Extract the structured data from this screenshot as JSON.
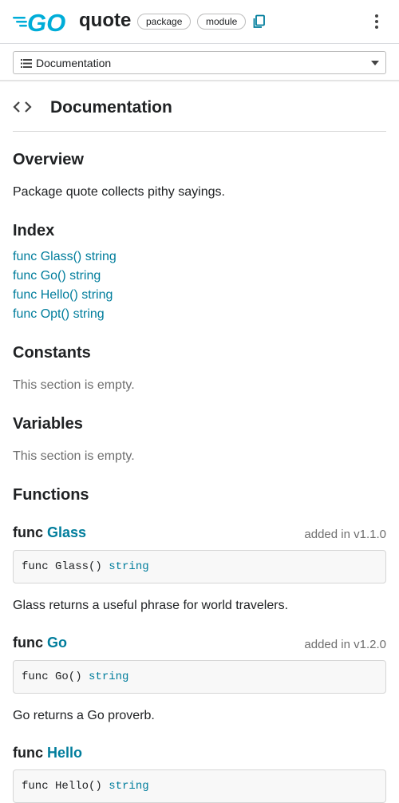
{
  "header": {
    "logo_icon": "go-logo-icon",
    "package_name": "quote",
    "badges": [
      "package",
      "module"
    ],
    "copy_icon": "copy-icon",
    "menu_icon": "kebab-menu-icon",
    "accent_color": "#00add8"
  },
  "doc_nav": {
    "label": "Documentation",
    "icon": "list-icon"
  },
  "doc_section": {
    "icon": "code-brackets-icon",
    "title": "Documentation"
  },
  "overview": {
    "heading": "Overview",
    "text": "Package quote collects pithy sayings."
  },
  "index": {
    "heading": "Index",
    "items": [
      "func Glass() string",
      "func Go() string",
      "func Hello() string",
      "func Opt() string"
    ]
  },
  "constants": {
    "heading": "Constants",
    "text": "This section is empty."
  },
  "variables": {
    "heading": "Variables",
    "text": "This section is empty."
  },
  "functions": {
    "heading": "Functions",
    "list": [
      {
        "keyword": "func",
        "name": "Glass",
        "added": "added in v1.1.0",
        "signature": "func Glass() ",
        "return_type": "string",
        "description": "Glass returns a useful phrase for world travelers."
      },
      {
        "keyword": "func",
        "name": "Go",
        "added": "added in v1.2.0",
        "signature": "func Go() ",
        "return_type": "string",
        "description": "Go returns a Go proverb."
      },
      {
        "keyword": "func",
        "name": "Hello",
        "added": "",
        "signature": "func Hello() ",
        "return_type": "string",
        "description": ""
      }
    ]
  },
  "colors": {
    "link": "#007d9c",
    "text": "#202224",
    "muted": "#6e6e6e"
  }
}
